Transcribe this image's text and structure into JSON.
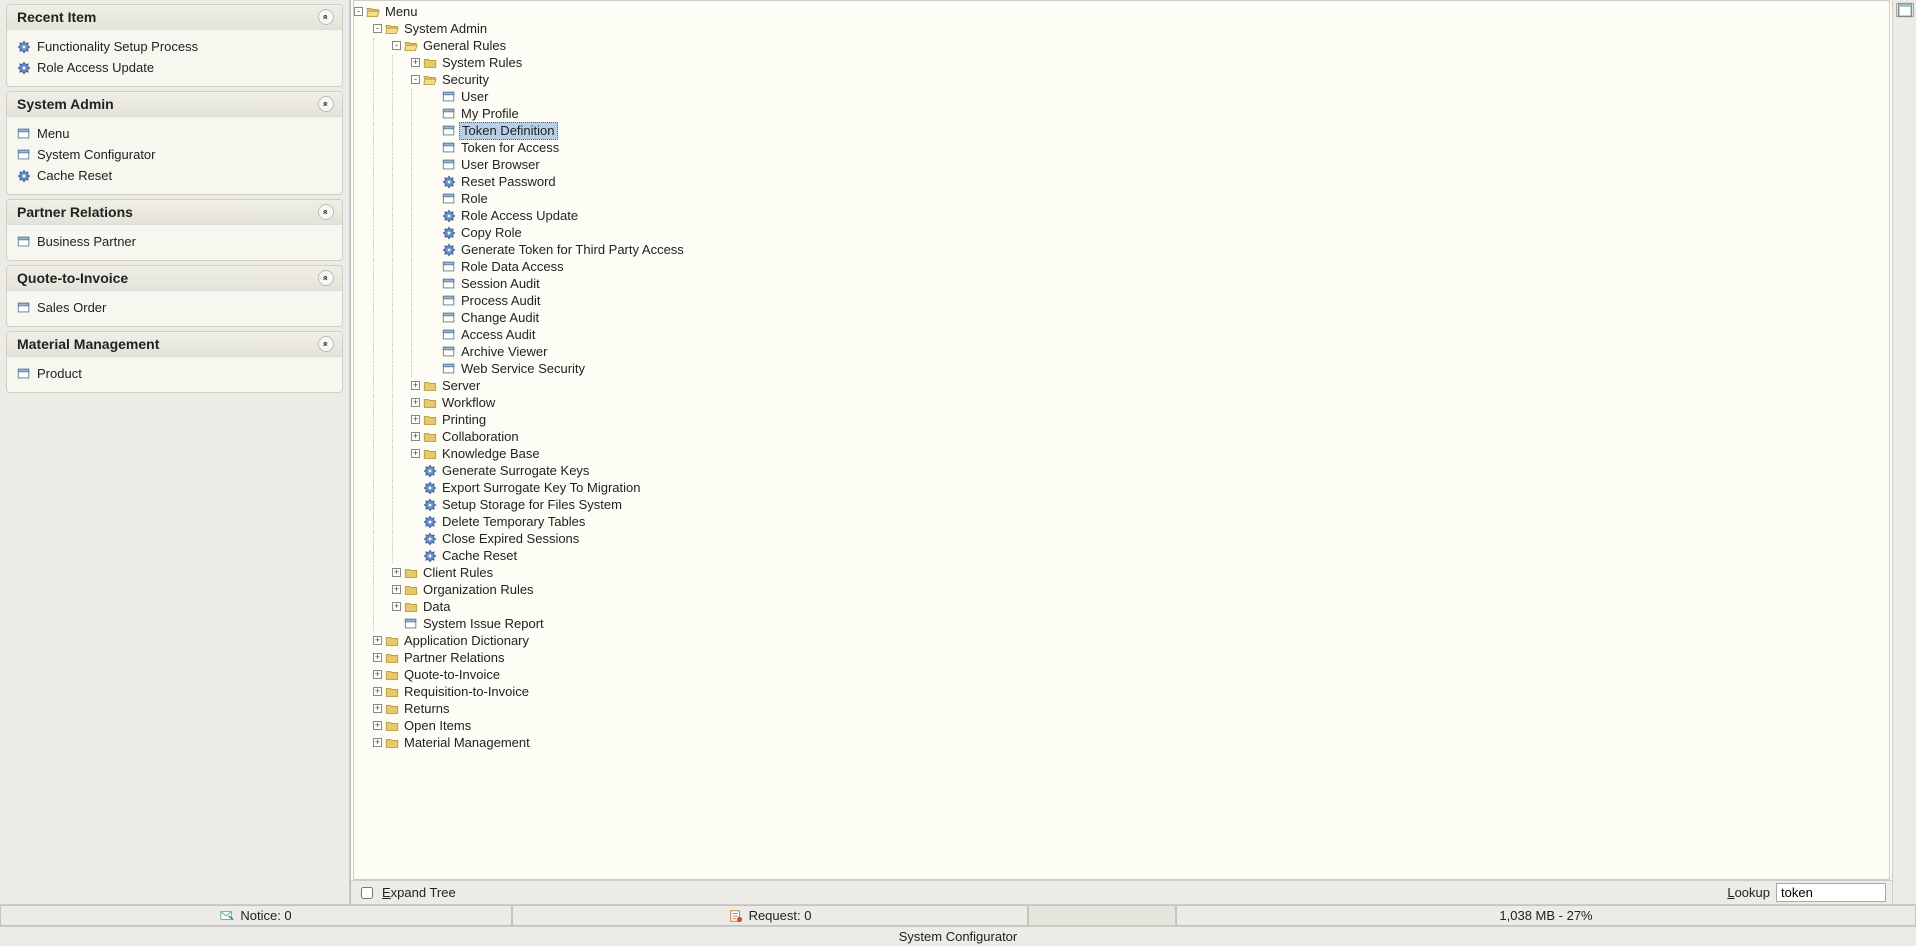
{
  "icons": {
    "gear": "gear",
    "window": "window",
    "folder_open": "folder-open",
    "folder": "folder",
    "mail": "mail",
    "request": "request"
  },
  "sidebar": {
    "sections": [
      {
        "title": "Recent Item",
        "items": [
          {
            "icon": "gear",
            "label": "Functionality Setup Process"
          },
          {
            "icon": "gear",
            "label": "Role Access Update"
          }
        ]
      },
      {
        "title": "System Admin",
        "items": [
          {
            "icon": "window",
            "label": "Menu"
          },
          {
            "icon": "window",
            "label": "System Configurator"
          },
          {
            "icon": "gear",
            "label": "Cache Reset"
          }
        ]
      },
      {
        "title": "Partner Relations",
        "items": [
          {
            "icon": "window",
            "label": "Business Partner"
          }
        ]
      },
      {
        "title": "Quote-to-Invoice",
        "items": [
          {
            "icon": "window",
            "label": "Sales Order"
          }
        ]
      },
      {
        "title": "Material Management",
        "items": [
          {
            "icon": "window",
            "label": "Product"
          }
        ]
      }
    ]
  },
  "tree": [
    {
      "d": 0,
      "exp": "-",
      "icon": "folder_open",
      "label": "Menu"
    },
    {
      "d": 1,
      "exp": "-",
      "icon": "folder_open",
      "label": "System Admin"
    },
    {
      "d": 2,
      "exp": "-",
      "icon": "folder_open",
      "label": "General Rules"
    },
    {
      "d": 3,
      "exp": "+",
      "icon": "folder",
      "label": "System Rules"
    },
    {
      "d": 3,
      "exp": "-",
      "icon": "folder_open",
      "label": "Security"
    },
    {
      "d": 4,
      "exp": " ",
      "icon": "window",
      "label": "User"
    },
    {
      "d": 4,
      "exp": " ",
      "icon": "window",
      "label": "My Profile"
    },
    {
      "d": 4,
      "exp": " ",
      "icon": "window",
      "label": "Token Definition",
      "selected": true
    },
    {
      "d": 4,
      "exp": " ",
      "icon": "window",
      "label": "Token for Access"
    },
    {
      "d": 4,
      "exp": " ",
      "icon": "window",
      "label": "User Browser"
    },
    {
      "d": 4,
      "exp": " ",
      "icon": "gear",
      "label": "Reset Password"
    },
    {
      "d": 4,
      "exp": " ",
      "icon": "window",
      "label": "Role"
    },
    {
      "d": 4,
      "exp": " ",
      "icon": "gear",
      "label": "Role Access Update"
    },
    {
      "d": 4,
      "exp": " ",
      "icon": "gear",
      "label": "Copy Role"
    },
    {
      "d": 4,
      "exp": " ",
      "icon": "gear",
      "label": "Generate Token for Third Party Access"
    },
    {
      "d": 4,
      "exp": " ",
      "icon": "window",
      "label": "Role Data Access"
    },
    {
      "d": 4,
      "exp": " ",
      "icon": "window",
      "label": "Session Audit"
    },
    {
      "d": 4,
      "exp": " ",
      "icon": "window",
      "label": "Process Audit"
    },
    {
      "d": 4,
      "exp": " ",
      "icon": "window",
      "label": "Change Audit"
    },
    {
      "d": 4,
      "exp": " ",
      "icon": "window",
      "label": "Access Audit"
    },
    {
      "d": 4,
      "exp": " ",
      "icon": "window",
      "label": "Archive Viewer"
    },
    {
      "d": 4,
      "exp": " ",
      "icon": "window",
      "label": "Web Service Security"
    },
    {
      "d": 3,
      "exp": "+",
      "icon": "folder",
      "label": "Server"
    },
    {
      "d": 3,
      "exp": "+",
      "icon": "folder",
      "label": "Workflow"
    },
    {
      "d": 3,
      "exp": "+",
      "icon": "folder",
      "label": "Printing"
    },
    {
      "d": 3,
      "exp": "+",
      "icon": "folder",
      "label": "Collaboration"
    },
    {
      "d": 3,
      "exp": "+",
      "icon": "folder",
      "label": "Knowledge Base"
    },
    {
      "d": 3,
      "exp": " ",
      "icon": "gear",
      "label": "Generate Surrogate Keys"
    },
    {
      "d": 3,
      "exp": " ",
      "icon": "gear",
      "label": "Export Surrogate Key To Migration"
    },
    {
      "d": 3,
      "exp": " ",
      "icon": "gear",
      "label": "Setup Storage for Files System"
    },
    {
      "d": 3,
      "exp": " ",
      "icon": "gear",
      "label": "Delete Temporary Tables"
    },
    {
      "d": 3,
      "exp": " ",
      "icon": "gear",
      "label": "Close Expired Sessions"
    },
    {
      "d": 3,
      "exp": " ",
      "icon": "gear",
      "label": "Cache Reset"
    },
    {
      "d": 2,
      "exp": "+",
      "icon": "folder",
      "label": "Client Rules"
    },
    {
      "d": 2,
      "exp": "+",
      "icon": "folder",
      "label": "Organization Rules"
    },
    {
      "d": 2,
      "exp": "+",
      "icon": "folder",
      "label": "Data"
    },
    {
      "d": 2,
      "exp": " ",
      "icon": "window",
      "label": "System Issue Report"
    },
    {
      "d": 1,
      "exp": "+",
      "icon": "folder",
      "label": "Application Dictionary"
    },
    {
      "d": 1,
      "exp": "+",
      "icon": "folder",
      "label": "Partner Relations"
    },
    {
      "d": 1,
      "exp": "+",
      "icon": "folder",
      "label": "Quote-to-Invoice"
    },
    {
      "d": 1,
      "exp": "+",
      "icon": "folder",
      "label": "Requisition-to-Invoice"
    },
    {
      "d": 1,
      "exp": "+",
      "icon": "folder",
      "label": "Returns"
    },
    {
      "d": 1,
      "exp": "+",
      "icon": "folder",
      "label": "Open Items"
    },
    {
      "d": 1,
      "exp": "+",
      "icon": "folder",
      "label": "Material Management"
    }
  ],
  "treefilter": {
    "expand_label": "Expand Tree",
    "expand_key": "E",
    "lookup_label": "Lookup",
    "lookup_key": "L",
    "lookup_value": "token"
  },
  "status": {
    "notice": "Notice: 0",
    "request": "Request: 0",
    "memory": "1,038 MB - 27%"
  },
  "footer": {
    "text": "System Configurator"
  }
}
